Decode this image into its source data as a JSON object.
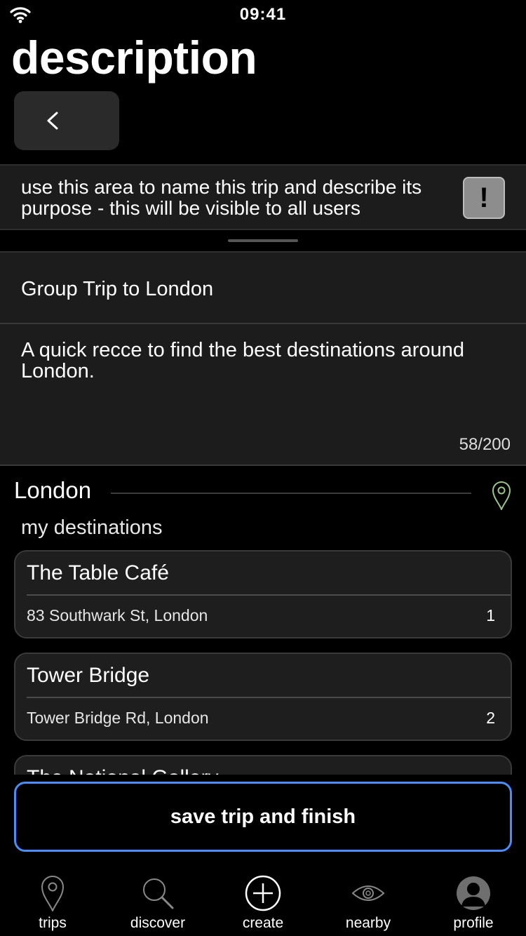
{
  "status_bar": {
    "time": "09:41"
  },
  "header": {
    "title": "description"
  },
  "info": {
    "text": "use this area to name this trip and describe its purpose - this will be visible to all users",
    "button_label": "!"
  },
  "form": {
    "trip_title": "Group Trip to London",
    "description": "A quick recce to find the best destinations around London.",
    "char_count": "58/200"
  },
  "location": {
    "city": "London",
    "subheading": "my destinations"
  },
  "destinations": [
    {
      "name": "The Table Café",
      "address": "83 Southwark St, London",
      "order": "1"
    },
    {
      "name": "Tower Bridge",
      "address": "Tower Bridge Rd, London",
      "order": "2"
    },
    {
      "name": "The National Gallery",
      "address": "",
      "order": ""
    }
  ],
  "actions": {
    "save_label": "save trip and finish"
  },
  "tabbar": {
    "tabs": [
      {
        "label": "trips",
        "icon": "location-pin-icon"
      },
      {
        "label": "discover",
        "icon": "magnifier-icon"
      },
      {
        "label": "create",
        "icon": "plus-circle-icon"
      },
      {
        "label": "nearby",
        "icon": "eye-icon"
      },
      {
        "label": "profile",
        "icon": "person-icon"
      }
    ]
  },
  "colors": {
    "accent_blue": "#4a8df8",
    "pin_green": "#9bc38a",
    "panel": "#1c1c1c"
  }
}
